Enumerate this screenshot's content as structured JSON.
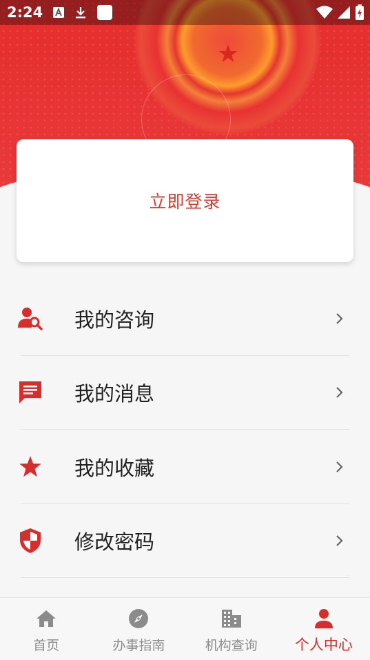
{
  "status_bar": {
    "time": "2:24"
  },
  "login": {
    "label": "立即登录"
  },
  "menu": {
    "items": [
      {
        "label": "我的咨询",
        "icon": "user-search-icon"
      },
      {
        "label": "我的消息",
        "icon": "message-icon"
      },
      {
        "label": "我的收藏",
        "icon": "star-icon"
      },
      {
        "label": "修改密码",
        "icon": "shield-icon"
      }
    ]
  },
  "bottom_nav": {
    "tabs": [
      {
        "label": "首页",
        "icon": "home-icon"
      },
      {
        "label": "办事指南",
        "icon": "compass-icon"
      },
      {
        "label": "机构查询",
        "icon": "building-icon"
      },
      {
        "label": "个人中心",
        "icon": "person-icon",
        "active": true
      }
    ]
  },
  "colors": {
    "primary": "#d62d2d",
    "login_text": "#e03a2f",
    "inactive": "#8b8b8b"
  }
}
